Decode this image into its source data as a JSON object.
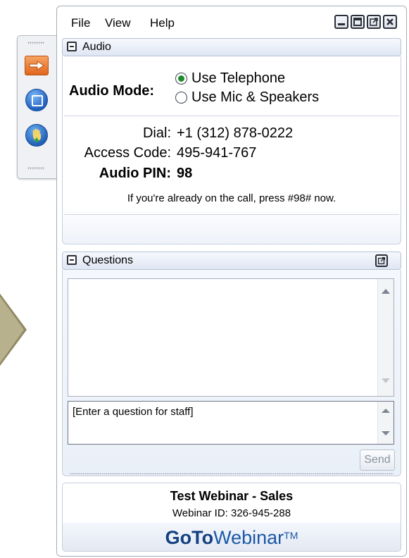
{
  "menu": {
    "file": "File",
    "view": "View",
    "help": "Help"
  },
  "audio": {
    "header": "Audio",
    "mode_label": "Audio Mode:",
    "options": [
      {
        "label": "Use Telephone",
        "selected": true
      },
      {
        "label": "Use Mic & Speakers",
        "selected": false
      }
    ],
    "dial_label": "Dial:",
    "dial_value": "+1 (312) 878-0222",
    "access_label": "Access Code:",
    "access_value": "495-941-767",
    "pin_label": "Audio PIN:",
    "pin_value": "98",
    "note": "If you're already on the call, press #98# now."
  },
  "questions": {
    "header": "Questions",
    "input_placeholder": "[Enter a question for staff]",
    "send_label": "Send"
  },
  "footer": {
    "title": "Test Webinar - Sales",
    "webinar_id": "Webinar ID: 326-945-288",
    "brand_bold": "GoTo",
    "brand_rest": "Webinar",
    "brand_tm": "TM"
  },
  "colors": {
    "accent": "#1c58a7",
    "brand_dark": "#143f82",
    "radio_selected": "#1d8a2f",
    "arrow_tile": "#e0661d"
  },
  "icons": [
    "minimize-icon",
    "restore-icon",
    "popout-icon",
    "close-icon",
    "collapse-icon",
    "arrow-right-icon",
    "stop-screen-icon",
    "raise-hand-icon"
  ]
}
